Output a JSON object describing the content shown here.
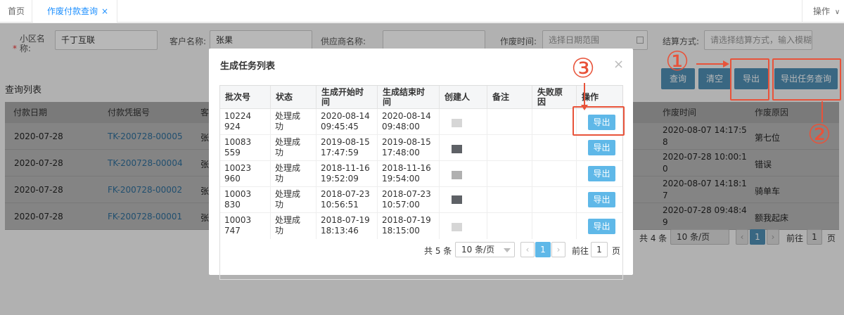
{
  "tabs": {
    "home": "首页",
    "active": "作废付款查询",
    "close": "×",
    "ops": "操作",
    "ops_chevron": "∨"
  },
  "filters": {
    "required_mark": "*",
    "community_label": "小区名称:",
    "community_value": "千丁互联",
    "customer_label": "客户名称:",
    "customer_value": "张果",
    "supplier_label": "供应商名称:",
    "supplier_value": "",
    "void_time_label": "作废时间:",
    "void_time_placeholder": "选择日期范围",
    "settle_label": "结算方式:",
    "settle_placeholder": "请选择结算方式，输入模糊"
  },
  "buttons": {
    "query": "查询",
    "clear": "清空",
    "export": "导出",
    "export_task": "导出任务查询"
  },
  "list": {
    "title": "查询列表",
    "headers": {
      "pay_date": "付款日期",
      "voucher": "付款凭据号",
      "customer_partial": "客",
      "void_time": "作废时间",
      "void_reason": "作废原因"
    },
    "rows": [
      {
        "date": "2020-07-28",
        "voucher": "TK-200728-00005",
        "cust": "张",
        "time_a": "2020-08-07 14:17:5",
        "time_b": "8",
        "reason": "第七位"
      },
      {
        "date": "2020-07-28",
        "voucher": "TK-200728-00004",
        "cust": "张",
        "time_a": "2020-07-28 10:00:1",
        "time_b": "0",
        "reason": "错误"
      },
      {
        "date": "2020-07-28",
        "voucher": "FK-200728-00002",
        "cust": "张",
        "time_a": "2020-08-07 14:18:1",
        "time_b": "7",
        "reason": "骑单车"
      },
      {
        "date": "2020-07-28",
        "voucher": "FK-200728-00001",
        "cust": "张",
        "time_a": "2020-07-28 09:48:4",
        "time_b": "9",
        "reason": "额我起床"
      }
    ],
    "pagination": {
      "total": "共 4 条",
      "page_size": "10 条/页",
      "current": "1",
      "goto": "前往",
      "goto_value": "1",
      "page_unit": "页",
      "prev": "‹",
      "next": "›"
    }
  },
  "modal": {
    "title": "生成任务列表",
    "close": "×",
    "headers": {
      "batch": "批次号",
      "status": "状态",
      "start_a": "生成开始时",
      "start_b": "间",
      "end_a": "生成结束时",
      "end_b": "间",
      "creator": "创建人",
      "remark": "备注",
      "fail_a": "失败原",
      "fail_b": "因",
      "action": "操作"
    },
    "rows": [
      {
        "batch_a": "10224",
        "batch_b": "924",
        "status_a": "处理成",
        "status_b": "功",
        "start_a": "2020-08-14",
        "start_b": "09:45:45",
        "end_a": "2020-08-14",
        "end_b": "09:48:00",
        "creator_shade": "light",
        "action": "导出"
      },
      {
        "batch_a": "10083",
        "batch_b": "559",
        "status_a": "处理成",
        "status_b": "功",
        "start_a": "2019-08-15",
        "start_b": "17:47:59",
        "end_a": "2019-08-15",
        "end_b": "17:48:00",
        "creator_shade": "dark",
        "action": "导出"
      },
      {
        "batch_a": "10023",
        "batch_b": "960",
        "status_a": "处理成",
        "status_b": "功",
        "start_a": "2018-11-16",
        "start_b": "19:52:09",
        "end_a": "2018-11-16",
        "end_b": "19:54:00",
        "creator_shade": "mid",
        "action": "导出"
      },
      {
        "batch_a": "10003",
        "batch_b": "830",
        "status_a": "处理成",
        "status_b": "功",
        "start_a": "2018-07-23",
        "start_b": "10:56:51",
        "end_a": "2018-07-23",
        "end_b": "10:57:00",
        "creator_shade": "dark",
        "action": "导出"
      },
      {
        "batch_a": "10003",
        "batch_b": "747",
        "status_a": "处理成",
        "status_b": "功",
        "start_a": "2018-07-19",
        "start_b": "18:13:46",
        "end_a": "2018-07-19",
        "end_b": "18:15:00",
        "creator_shade": "light",
        "action": "导出"
      }
    ],
    "pagination": {
      "total": "共 5 条",
      "page_size": "10 条/页",
      "current": "1",
      "goto": "前往",
      "goto_value": "1",
      "page_unit": "页",
      "prev": "‹",
      "next": "›"
    }
  },
  "annotations": {
    "one": "①",
    "two": "②",
    "three": "③"
  },
  "colors": {
    "accent": "#1e90ff",
    "annotation_red": "#e8533a",
    "export_button": "#5fb8e8"
  }
}
